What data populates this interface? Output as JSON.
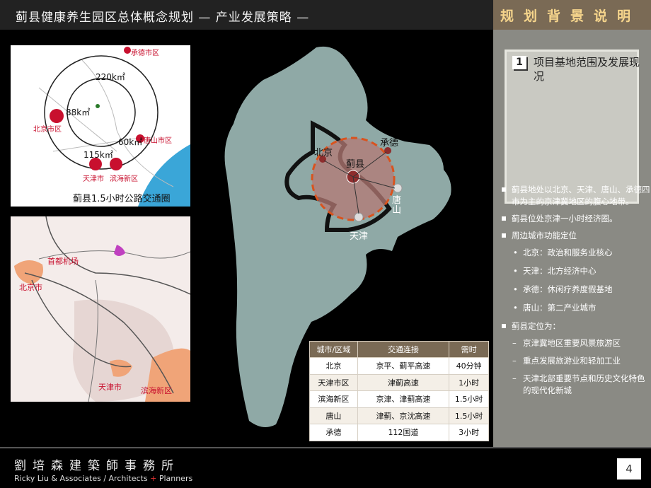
{
  "header": {
    "title": "蓟县健康养生园区总体概念规划    —  产业发展策略  —",
    "section": "规划背景说明"
  },
  "map1": {
    "labels": {
      "chengde": "承德市区",
      "beijing": "北京市区",
      "tangshan": "唐山市区",
      "tianjin": "天津市",
      "binhai": "滨海新区",
      "r220": "220k㎡",
      "r88": "88k㎡",
      "r60": "60k㎡",
      "r115": "115k㎡"
    },
    "caption": "蓟县1.5小时公路交通圈"
  },
  "map2": {
    "labels": {
      "airport": "首都机场",
      "beijing": "北京市",
      "tianjin": "天津市",
      "binhai": "滨海新区"
    }
  },
  "center_map": {
    "labels": {
      "beijing": "北京",
      "jixian": "蓟县",
      "chengde": "承德",
      "tangshan": "唐山",
      "tianjin": "天津"
    }
  },
  "traffic_table": {
    "headers": [
      "城市/区域",
      "交通连接",
      "需时"
    ],
    "rows": [
      [
        "北京",
        "京平、蓟平高速",
        "40分钟"
      ],
      [
        "天津市区",
        "津蓟高速",
        "1小时"
      ],
      [
        "滨海新区",
        "京津、津蓟高速",
        "1.5小时"
      ],
      [
        "唐山",
        "津蓟、京沈高速",
        "1.5小时"
      ],
      [
        "承德",
        "112国道",
        "3小时"
      ]
    ]
  },
  "panel": {
    "number": "1",
    "heading": "项目基地范围及发展现况",
    "bullets": [
      "蓟县地处以北京、天津、唐山、承德四市为主的京津冀地区的腹心地带。",
      "蓟县位处京津一小时经济圈。",
      "周边城市功能定位",
      "北京：政治和服务业核心",
      "天津：北方经济中心",
      "承德：休闲疗养度假基地",
      "唐山：第二产业城市",
      "蓟县定位为：",
      "京津冀地区重要风景旅游区",
      "重点发展旅游业和轻加工业",
      "天津北部重要节点和历史文化特色的现代化新城"
    ]
  },
  "footer": {
    "firm_cn": "劉培森建築師事務所",
    "firm_en_pre": "Ricky Liu & Associates / Architects",
    "firm_plus": "+",
    "firm_en_post": "Planners",
    "page": "4"
  },
  "colors": {
    "header_bg": "#222222",
    "section_bg": "#7a6a55",
    "section_text": "#f6d58c",
    "panel_bg": "#8a8a84",
    "map_land": "#8fa9a6",
    "accent_red": "#c8102e"
  }
}
